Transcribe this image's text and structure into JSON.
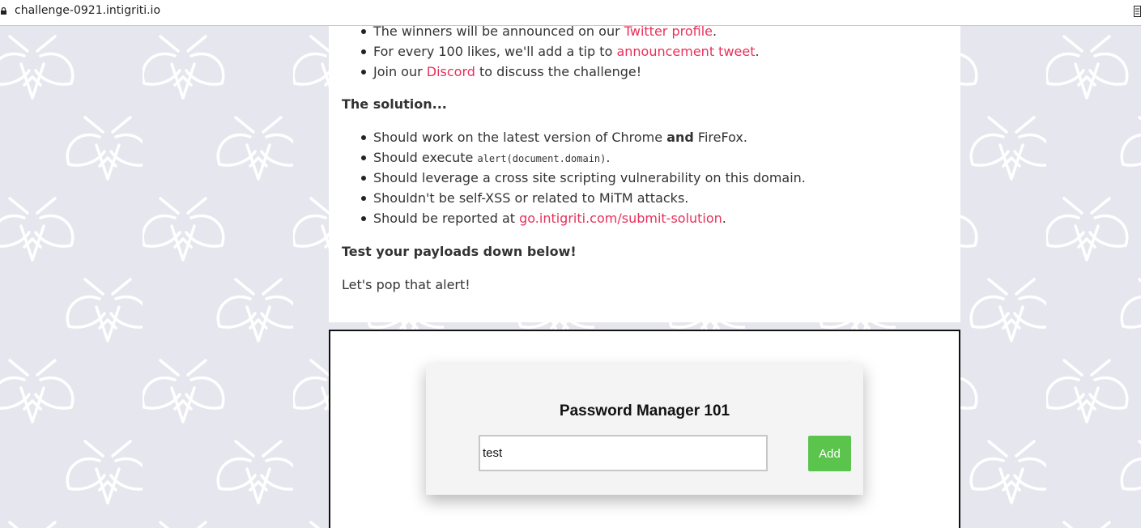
{
  "browser": {
    "url": "challenge-0921.intigriti.io",
    "lock_icon": "lock-icon",
    "reader_icon": "reader-view-icon"
  },
  "colors": {
    "background": "#e6e6ee",
    "pattern": "#ffffff",
    "link": "#e8305a",
    "add_button": "#5ac44c"
  },
  "rules": {
    "items": [
      {
        "before": "The winners will be announced on our ",
        "link": "Twitter profile",
        "after": "."
      },
      {
        "before": "For every 100 likes, we'll add a tip to ",
        "link": "announcement tweet",
        "after": "."
      },
      {
        "before": "Join our ",
        "link": "Discord",
        "after": " to discuss the challenge!"
      }
    ]
  },
  "solution": {
    "heading": "The solution...",
    "item1": {
      "before": "Should work on the latest version of Chrome ",
      "bold": "and",
      "after": " FireFox."
    },
    "item2": {
      "before": "Should execute ",
      "code": "alert(document.domain)",
      "after": "."
    },
    "item3": "Should leverage a cross site scripting vulnerability on this domain.",
    "item4": "Shouldn't be self-XSS or related to MiTM attacks.",
    "item5": {
      "before": "Should be reported at ",
      "link": "go.intigriti.com/submit-solution",
      "after": "."
    }
  },
  "test": {
    "heading": "Test your payloads down below!",
    "text": "Let's pop that alert!"
  },
  "password_manager": {
    "title": "Password Manager 101",
    "input_value": "test",
    "add_label": "Add"
  }
}
